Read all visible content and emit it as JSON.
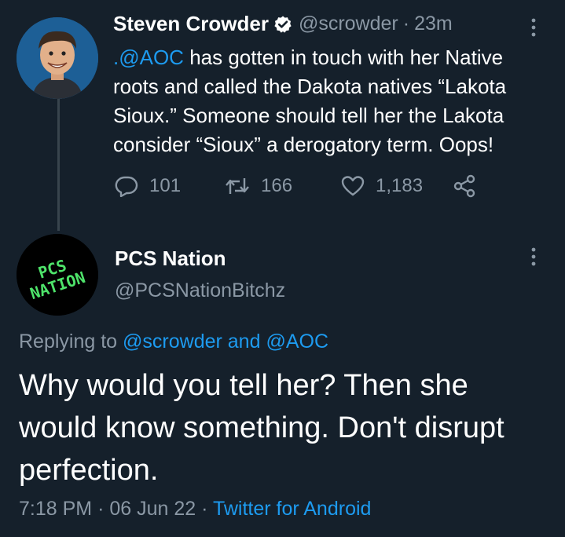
{
  "parent_tweet": {
    "display_name": "Steven Crowder",
    "handle": "@scrowder",
    "separator": "·",
    "time_ago": "23m",
    "mention": ".@AOC",
    "text": " has gotten in touch with her Native roots and called the Dakota natives “Lakota Sioux.” Someone should tell her the Lakota consider “Sioux” a derogatory term. Oops!",
    "reply_count": "101",
    "retweet_count": "166",
    "like_count": "1,183",
    "verified_icon": "verified-badge-icon"
  },
  "reply_tweet": {
    "display_name": "PCS Nation",
    "handle": "@PCSNationBitchz",
    "avatar_text": "PCS NATION",
    "replying_prefix": "Replying to",
    "replying_user1": "@scrowder",
    "replying_and": "and",
    "replying_user2": "@AOC",
    "text": "Why would you tell her? Then she would know something. Don't disrupt perfection.",
    "time": "7:18 PM",
    "dot": "·",
    "date": "06 Jun 22",
    "source": "Twitter for Android"
  },
  "colors": {
    "background": "#15202b",
    "link": "#1d9bf0",
    "muted": "#8b98a5",
    "avatar_text": "#4ee36a"
  }
}
